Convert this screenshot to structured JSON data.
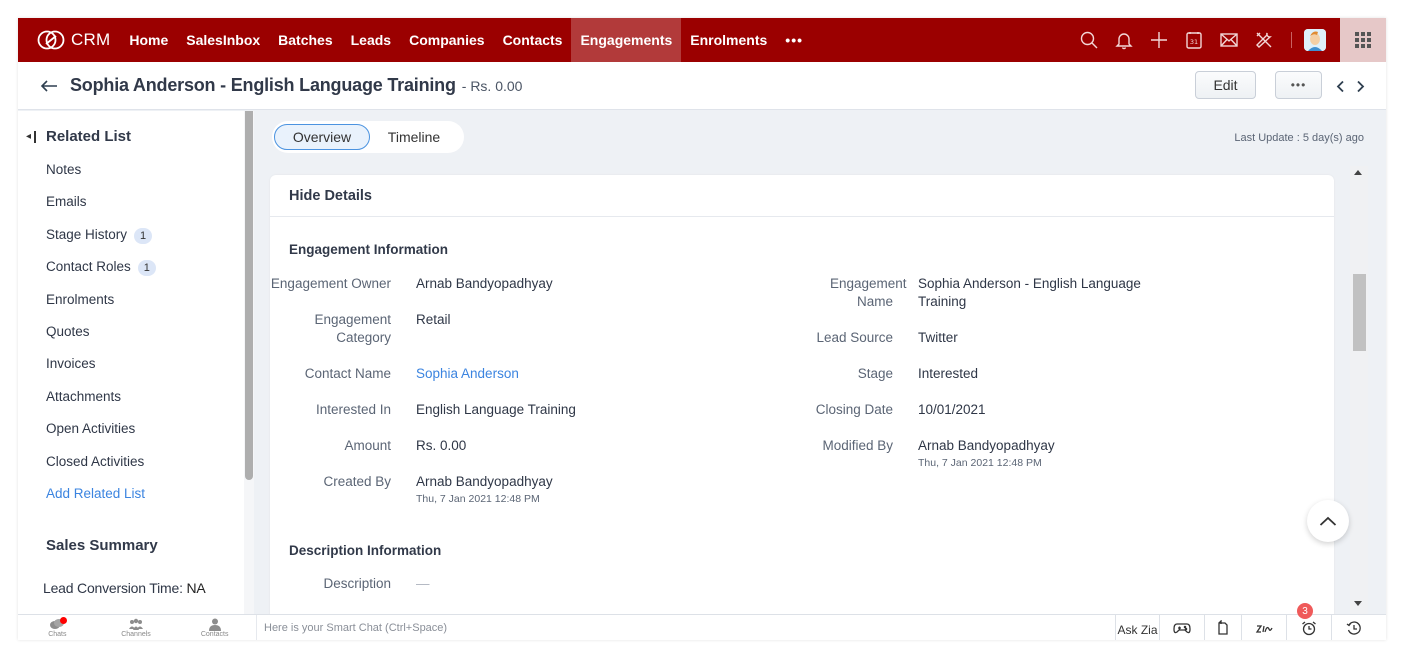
{
  "app": {
    "name": "CRM",
    "logo_icon": "zoho-rings-icon"
  },
  "topnav": {
    "items": [
      {
        "label": "Home",
        "active": false
      },
      {
        "label": "SalesInbox",
        "active": false
      },
      {
        "label": "Batches",
        "active": false
      },
      {
        "label": "Leads",
        "active": false
      },
      {
        "label": "Companies",
        "active": false
      },
      {
        "label": "Contacts",
        "active": false
      },
      {
        "label": "Engagements",
        "active": true
      },
      {
        "label": "Enrolments",
        "active": false
      }
    ],
    "more_label": "•••",
    "icons": [
      "search-icon",
      "bell-icon",
      "plus-icon",
      "calendar-icon",
      "mail-icon",
      "tools-icon",
      "avatar",
      "apps-grid-icon"
    ],
    "calendar_day": "31",
    "brand_color": "#9b0000",
    "active_color": "#b23a3a"
  },
  "record": {
    "title": "Sophia Anderson - English Language Training",
    "amount": "- Rs. 0.00",
    "edit_label": "Edit",
    "more_label": "•••"
  },
  "sidebar": {
    "related_list_title": "Related List",
    "items": [
      {
        "label": "Notes",
        "badge": null
      },
      {
        "label": "Emails",
        "badge": null
      },
      {
        "label": "Stage History",
        "badge": "1"
      },
      {
        "label": "Contact Roles",
        "badge": "1"
      },
      {
        "label": "Enrolments",
        "badge": null
      },
      {
        "label": "Quotes",
        "badge": null
      },
      {
        "label": "Invoices",
        "badge": null
      },
      {
        "label": "Attachments",
        "badge": null
      },
      {
        "label": "Open Activities",
        "badge": null
      },
      {
        "label": "Closed Activities",
        "badge": null
      }
    ],
    "add_related_list": "Add Related List",
    "sales_summary_title": "Sales Summary",
    "lead_conversion_label": "Lead Conversion Time:",
    "lead_conversion_value": "NA"
  },
  "tabs": {
    "overview": "Overview",
    "timeline": "Timeline",
    "active": "Overview"
  },
  "last_update": "Last Update : 5 day(s) ago",
  "details": {
    "hide_details": "Hide Details",
    "engagement_section": "Engagement Information",
    "left_fields": [
      {
        "label": "Engagement Owner",
        "value": "Arnab Bandyopadhyay"
      },
      {
        "label": "Engagement Category",
        "value": "Retail"
      },
      {
        "label": "Contact Name",
        "value": "Sophia Anderson",
        "link": true
      },
      {
        "label": "Interested In",
        "value": "English Language Training"
      },
      {
        "label": "Amount",
        "value": "Rs. 0.00"
      },
      {
        "label": "Created By",
        "value": "Arnab Bandyopadhyay",
        "sub": "Thu, 7 Jan 2021 12:48 PM"
      }
    ],
    "right_fields": [
      {
        "label": "Engagement Name",
        "value": "Sophia Anderson - English Language Training"
      },
      {
        "label": "Lead Source",
        "value": "Twitter"
      },
      {
        "label": "Stage",
        "value": "Interested"
      },
      {
        "label": "Closing Date",
        "value": "10/01/2021"
      },
      {
        "label": "Modified By",
        "value": "Arnab Bandyopadhyay",
        "sub": "Thu, 7 Jan 2021 12:48 PM"
      }
    ],
    "description_section": "Description Information",
    "description_label": "Description",
    "description_value": "—"
  },
  "bottombar": {
    "dock": [
      {
        "label": "Chats",
        "icon": "chat-bubbles-icon",
        "notification": true
      },
      {
        "label": "Channels",
        "icon": "group-icon",
        "notification": false
      },
      {
        "label": "Contacts",
        "icon": "person-icon",
        "notification": false
      }
    ],
    "smart_chat_placeholder": "Here is your Smart Chat (Ctrl+Space)",
    "ask_zia": "Ask Zia",
    "tools": [
      "gamepad-icon",
      "notes-icon",
      "signature-icon",
      "alarm-icon",
      "history-icon"
    ],
    "alarm_badge": "3"
  }
}
